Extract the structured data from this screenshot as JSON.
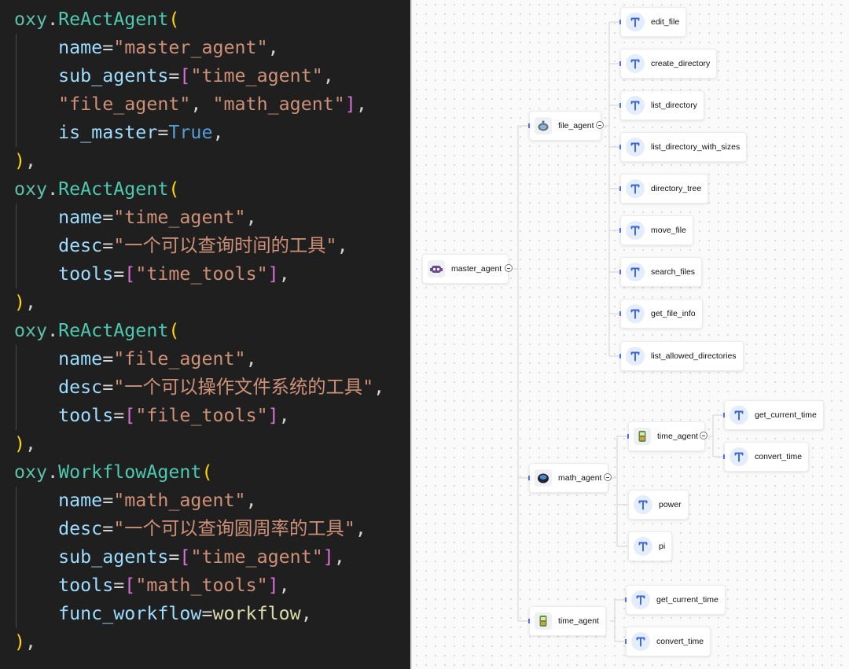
{
  "code": {
    "lines": [
      [
        [
          "oxy",
          "obj"
        ],
        [
          ".",
          "op"
        ],
        [
          "ReActAgent",
          "cls"
        ],
        [
          "(",
          "b1"
        ]
      ],
      [
        [
          "    ",
          "op"
        ],
        [
          "name",
          "id"
        ],
        [
          "=",
          "op"
        ],
        [
          "\"master_agent\"",
          "str"
        ],
        [
          ",",
          "op"
        ]
      ],
      [
        [
          "    ",
          "op"
        ],
        [
          "sub_agents",
          "id"
        ],
        [
          "=",
          "op"
        ],
        [
          "[",
          "b2"
        ],
        [
          "\"time_agent\"",
          "str"
        ],
        [
          ",",
          "op"
        ]
      ],
      [
        [
          "    ",
          "op"
        ],
        [
          "\"file_agent\"",
          "str"
        ],
        [
          ", ",
          "op"
        ],
        [
          "\"math_agent\"",
          "str"
        ],
        [
          "]",
          "b2"
        ],
        [
          ",",
          "op"
        ]
      ],
      [
        [
          "    ",
          "op"
        ],
        [
          "is_master",
          "id"
        ],
        [
          "=",
          "op"
        ],
        [
          "True",
          "kw"
        ],
        [
          ",",
          "op"
        ]
      ],
      [
        [
          ")",
          "b1"
        ],
        [
          ",",
          "op"
        ]
      ],
      [
        [
          "oxy",
          "obj"
        ],
        [
          ".",
          "op"
        ],
        [
          "ReActAgent",
          "cls"
        ],
        [
          "(",
          "b1"
        ]
      ],
      [
        [
          "    ",
          "op"
        ],
        [
          "name",
          "id"
        ],
        [
          "=",
          "op"
        ],
        [
          "\"time_agent\"",
          "str"
        ],
        [
          ",",
          "op"
        ]
      ],
      [
        [
          "    ",
          "op"
        ],
        [
          "desc",
          "id"
        ],
        [
          "=",
          "op"
        ],
        [
          "\"一个可以查询时间的工具\"",
          "str"
        ],
        [
          ",",
          "op"
        ]
      ],
      [
        [
          "    ",
          "op"
        ],
        [
          "tools",
          "id"
        ],
        [
          "=",
          "op"
        ],
        [
          "[",
          "b2"
        ],
        [
          "\"time_tools\"",
          "str"
        ],
        [
          "]",
          "b2"
        ],
        [
          ",",
          "op"
        ]
      ],
      [
        [
          ")",
          "b1"
        ],
        [
          ",",
          "op"
        ]
      ],
      [
        [
          "oxy",
          "obj"
        ],
        [
          ".",
          "op"
        ],
        [
          "ReActAgent",
          "cls"
        ],
        [
          "(",
          "b1"
        ]
      ],
      [
        [
          "    ",
          "op"
        ],
        [
          "name",
          "id"
        ],
        [
          "=",
          "op"
        ],
        [
          "\"file_agent\"",
          "str"
        ],
        [
          ",",
          "op"
        ]
      ],
      [
        [
          "    ",
          "op"
        ],
        [
          "desc",
          "id"
        ],
        [
          "=",
          "op"
        ],
        [
          "\"一个可以操作文件系统的工具\"",
          "str"
        ],
        [
          ",",
          "op"
        ]
      ],
      [
        [
          "    ",
          "op"
        ],
        [
          "tools",
          "id"
        ],
        [
          "=",
          "op"
        ],
        [
          "[",
          "b2"
        ],
        [
          "\"file_tools\"",
          "str"
        ],
        [
          "]",
          "b2"
        ],
        [
          ",",
          "op"
        ]
      ],
      [
        [
          ")",
          "b1"
        ],
        [
          ",",
          "op"
        ]
      ],
      [
        [
          "oxy",
          "obj"
        ],
        [
          ".",
          "op"
        ],
        [
          "WorkflowAgent",
          "cls"
        ],
        [
          "(",
          "b1"
        ]
      ],
      [
        [
          "    ",
          "op"
        ],
        [
          "name",
          "id"
        ],
        [
          "=",
          "op"
        ],
        [
          "\"math_agent\"",
          "str"
        ],
        [
          ",",
          "op"
        ]
      ],
      [
        [
          "    ",
          "op"
        ],
        [
          "desc",
          "id"
        ],
        [
          "=",
          "op"
        ],
        [
          "\"一个可以查询圆周率的工具\"",
          "str"
        ],
        [
          ",",
          "op"
        ]
      ],
      [
        [
          "    ",
          "op"
        ],
        [
          "sub_agents",
          "id"
        ],
        [
          "=",
          "op"
        ],
        [
          "[",
          "b2"
        ],
        [
          "\"time_agent\"",
          "str"
        ],
        [
          "]",
          "b2"
        ],
        [
          ",",
          "op"
        ]
      ],
      [
        [
          "    ",
          "op"
        ],
        [
          "tools",
          "id"
        ],
        [
          "=",
          "op"
        ],
        [
          "[",
          "b2"
        ],
        [
          "\"math_tools\"",
          "str"
        ],
        [
          "]",
          "b2"
        ],
        [
          ",",
          "op"
        ]
      ],
      [
        [
          "    ",
          "op"
        ],
        [
          "func_workflow",
          "id"
        ],
        [
          "=",
          "op"
        ],
        [
          "workflow",
          "fn"
        ],
        [
          ",",
          "op"
        ]
      ],
      [
        [
          ")",
          "b1"
        ],
        [
          ",",
          "op"
        ]
      ]
    ]
  },
  "mindmap": {
    "root": {
      "label": "master_agent",
      "icon": "robot-icon",
      "children": [
        {
          "label": "file_agent",
          "icon": "robot-icon",
          "children": [
            {
              "label": "edit_file",
              "icon": "tool-icon"
            },
            {
              "label": "create_directory",
              "icon": "tool-icon"
            },
            {
              "label": "list_directory",
              "icon": "tool-icon"
            },
            {
              "label": "list_directory_with_sizes",
              "icon": "tool-icon"
            },
            {
              "label": "directory_tree",
              "icon": "tool-icon"
            },
            {
              "label": "move_file",
              "icon": "tool-icon"
            },
            {
              "label": "search_files",
              "icon": "tool-icon"
            },
            {
              "label": "get_file_info",
              "icon": "tool-icon"
            },
            {
              "label": "list_allowed_directories",
              "icon": "tool-icon"
            }
          ]
        },
        {
          "label": "math_agent",
          "icon": "robot-icon",
          "children": [
            {
              "label": "time_agent",
              "icon": "robot-icon",
              "children": [
                {
                  "label": "get_current_time",
                  "icon": "tool-icon"
                },
                {
                  "label": "convert_time",
                  "icon": "tool-icon"
                }
              ]
            },
            {
              "label": "power",
              "icon": "tool-icon"
            },
            {
              "label": "pi",
              "icon": "tool-icon"
            }
          ]
        },
        {
          "label": "time_agent",
          "icon": "robot-icon",
          "children": [
            {
              "label": "get_current_time",
              "icon": "tool-icon"
            },
            {
              "label": "convert_time",
              "icon": "tool-icon"
            }
          ]
        }
      ]
    }
  },
  "colors": {
    "tool_icon": "#3a63d6",
    "tick": "#4f6ef7"
  }
}
